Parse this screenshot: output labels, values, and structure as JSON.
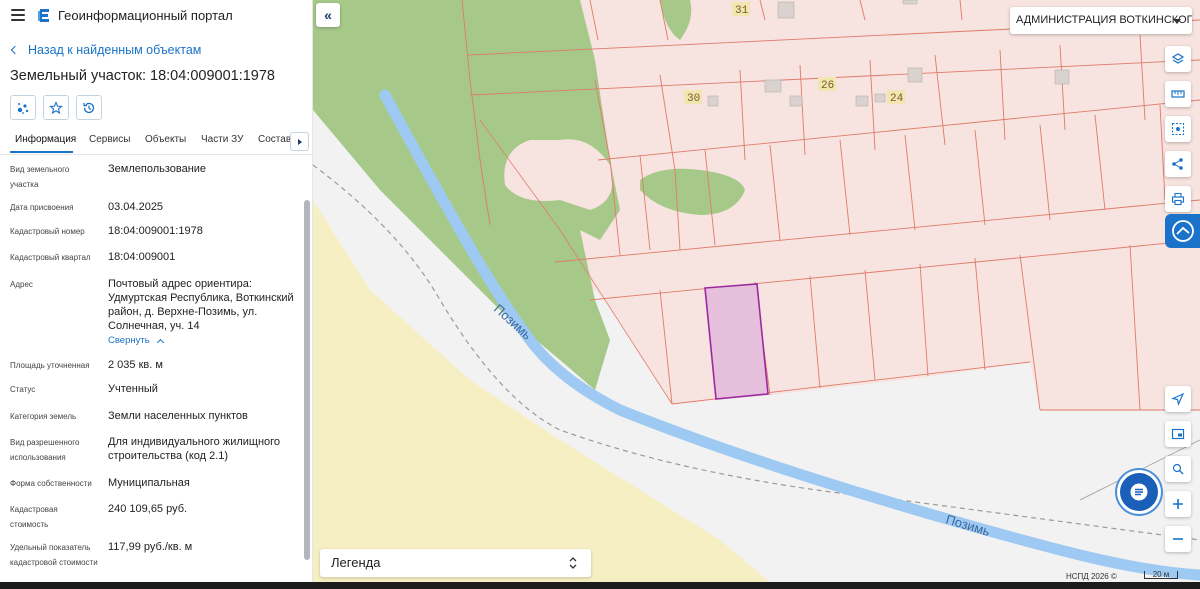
{
  "header": {
    "app_title": "Геоинформационный портал"
  },
  "nav": {
    "back_label": "Назад к найденным объектам"
  },
  "object": {
    "title": "Земельный участок: 18:04:009001:1978"
  },
  "actions": [
    {
      "icon": "cluster-select-icon"
    },
    {
      "icon": "star-icon"
    },
    {
      "icon": "history-icon"
    }
  ],
  "tabs": [
    "Информация",
    "Сервисы",
    "Объекты",
    "Части ЗУ",
    "Состав"
  ],
  "active_tab": "Информация",
  "info": {
    "vid": {
      "label": "Вид земельного участка",
      "value": "Землепользование"
    },
    "date": {
      "label": "Дата присвоения",
      "value": "03.04.2025"
    },
    "cadnum": {
      "label": "Кадастровый номер",
      "value": "18:04:009001:1978"
    },
    "quarter": {
      "label": "Кадастровый квартал",
      "value": "18:04:009001"
    },
    "address": {
      "label": "Адрес",
      "value": "Почтовый адрес ориентира: Удмуртская Республика, Воткинский район, д. Верхне-Позимь, ул. Солнечная, уч. 14",
      "toggle": "Свернуть"
    },
    "area": {
      "label": "Площадь уточненная",
      "value": "2 035 кв. м"
    },
    "status": {
      "label": "Статус",
      "value": "Учтенный"
    },
    "category": {
      "label": "Категория земель",
      "value": "Земли населенных пунктов"
    },
    "permitted_use": {
      "label": "Вид разрешенного использования",
      "value": "Для индивидуального жилищного строительства (код 2.1)"
    },
    "ownership": {
      "label": "Форма собственности",
      "value": "Муниципальная"
    },
    "cad_value": {
      "label": "Кадастровая стоимость",
      "value": "240 109,65 руб."
    },
    "specific_value": {
      "label": "Удельный показатель кадастровой стоимости",
      "value": "117,99 руб./кв. м"
    }
  },
  "map": {
    "region_select": "АДМИНИСТРАЦИЯ ВОТКИНСКОГО РАЙОНА",
    "legend_label": "Легенда",
    "river_label": "Позимь",
    "house_numbers": [
      "31",
      "30",
      "26",
      "24"
    ],
    "attribution": "НСПД 2026 ©",
    "scale_label": "20 м",
    "colors": {
      "parcel_fill": "#f7e3df",
      "parcel_line": "#e07a6a",
      "forest": "#a6c98a",
      "river": "#9ec9f2",
      "sand": "#f6efc4",
      "selected_fill": "#e6bfdc",
      "selected_line": "#9b2aa0",
      "accent": "#1a73c8"
    }
  },
  "controls": [
    "layers-icon",
    "ruler-icon",
    "select-area-icon",
    "share-icon",
    "print-icon",
    "active-layer-icon",
    "locate-icon",
    "minimap-icon",
    "geo-search-icon",
    "zoom-in-icon",
    "zoom-out-icon"
  ]
}
